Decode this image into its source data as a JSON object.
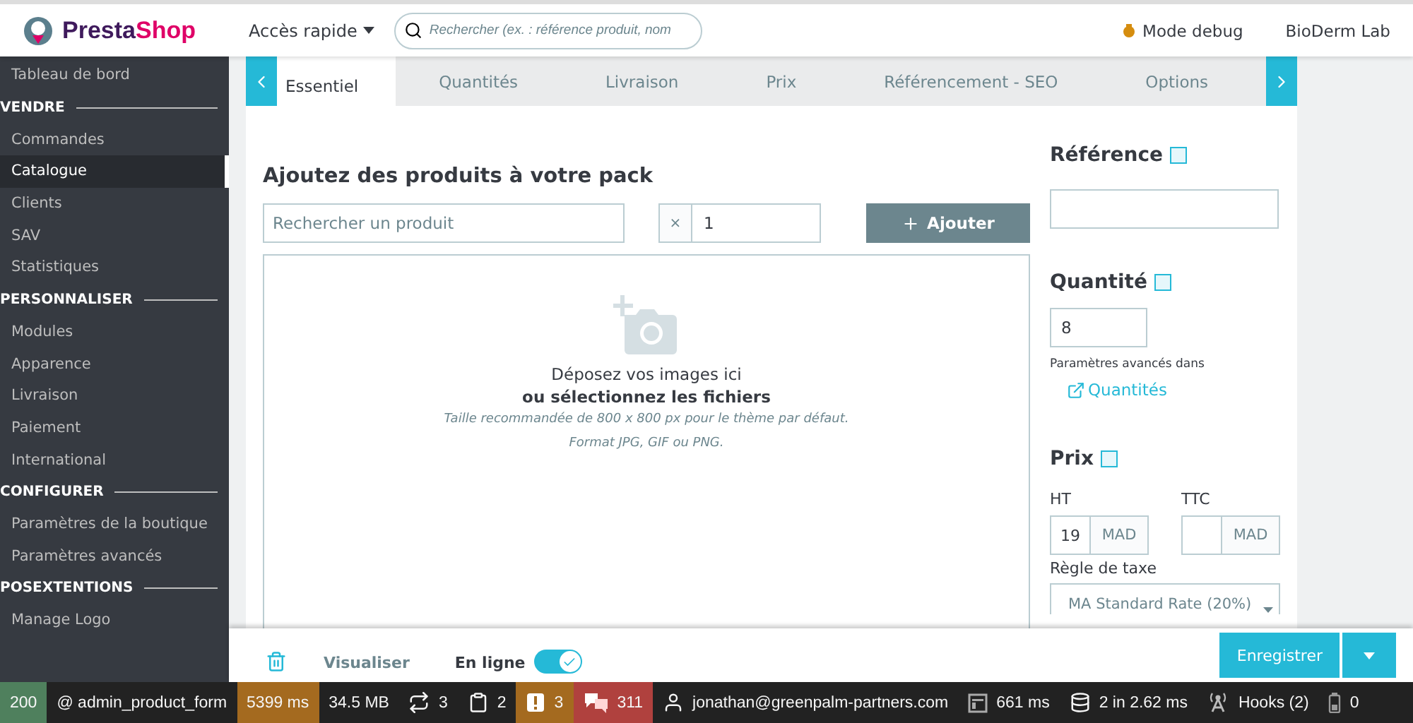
{
  "header": {
    "logo": {
      "name": "Presta",
      "accent": "Shop"
    },
    "quick_access": "Accès rapide",
    "search": {
      "placeholder": "Rechercher (ex. : référence produit, nom"
    },
    "debug_mode": "Mode debug",
    "shop": "BioDerm Lab"
  },
  "sidebar": {
    "items": [
      {
        "kind": "link",
        "label": "Tableau de bord",
        "selected": false
      },
      {
        "kind": "section",
        "label": "VENDRE"
      },
      {
        "kind": "link",
        "label": "Commandes",
        "selected": false
      },
      {
        "kind": "link",
        "label": "Catalogue",
        "selected": true
      },
      {
        "kind": "link",
        "label": "Clients",
        "selected": false
      },
      {
        "kind": "link",
        "label": "SAV",
        "selected": false
      },
      {
        "kind": "link",
        "label": "Statistiques",
        "selected": false
      },
      {
        "kind": "section",
        "label": "PERSONNALISER"
      },
      {
        "kind": "link",
        "label": "Modules",
        "selected": false
      },
      {
        "kind": "link",
        "label": "Apparence",
        "selected": false
      },
      {
        "kind": "link",
        "label": "Livraison",
        "selected": false
      },
      {
        "kind": "link",
        "label": "Paiement",
        "selected": false
      },
      {
        "kind": "link",
        "label": "International",
        "selected": false
      },
      {
        "kind": "section",
        "label": "CONFIGURER"
      },
      {
        "kind": "link",
        "label": "Paramètres de la boutique",
        "selected": false
      },
      {
        "kind": "link",
        "label": "Paramètres avancés",
        "selected": false
      },
      {
        "kind": "section",
        "label": "POSEXTENTIONS"
      },
      {
        "kind": "link",
        "label": "Manage Logo",
        "selected": false
      }
    ]
  },
  "tabs": [
    {
      "label": "Essentiel",
      "selected": true
    },
    {
      "label": "Quantités",
      "selected": false
    },
    {
      "label": "Livraison",
      "selected": false
    },
    {
      "label": "Prix",
      "selected": false
    },
    {
      "label": "Référencement - SEO",
      "selected": false
    },
    {
      "label": "Options",
      "selected": false
    }
  ],
  "pack": {
    "title": "Ajoutez des produits à votre pack",
    "search": {
      "placeholder": "Rechercher un produit"
    },
    "multiplier": "×",
    "quantity": "1",
    "add_button": "Ajouter",
    "dropzone": {
      "line_1": "Déposez vos images ici",
      "line_2": "ou sélectionnez les fichiers",
      "hint_1": "Taille recommandée de 800 x 800 px pour le thème par défaut.",
      "hint_2": "Format JPG, GIF ou PNG."
    }
  },
  "details": {
    "reference": {
      "label": "Référence"
    },
    "quantity": {
      "label": "Quantité",
      "value": "8",
      "hint": "Paramètres avancés dans",
      "link": "Quantités"
    },
    "price": {
      "label": "Prix",
      "ht_label": "HT",
      "ht_value": "19",
      "ht_currency": "MAD",
      "ttc_label": "TTC",
      "ttc_currency": "MAD"
    },
    "tax": {
      "label": "Règle de taxe",
      "value": "MA Standard Rate (20%)"
    }
  },
  "footer": {
    "preview": "Visualiser",
    "online_label": "En ligne",
    "online": true,
    "save": "Enregistrer"
  },
  "debug_bar": [
    {
      "kind": "status",
      "text": "200",
      "color": "#4f805d"
    },
    {
      "kind": "route",
      "text": "@ admin_product_form"
    },
    {
      "kind": "time",
      "text": "5399 ms",
      "color": "#a46a1f"
    },
    {
      "kind": "memory",
      "text": "34.5 MB"
    },
    {
      "kind": "loop",
      "text": "3"
    },
    {
      "kind": "clipboard",
      "text": "2"
    },
    {
      "kind": "warning",
      "text": "3",
      "color": "#a46a1f"
    },
    {
      "kind": "translation",
      "text": "311",
      "color": "#b0413e"
    },
    {
      "kind": "user",
      "text": "jonathan@greenpalm-partners.com"
    },
    {
      "kind": "layout",
      "text": "661 ms"
    },
    {
      "kind": "database",
      "text": "2 in 2.62 ms"
    },
    {
      "kind": "hooks",
      "text": "Hooks (2)"
    },
    {
      "kind": "battery",
      "text": "0"
    }
  ]
}
